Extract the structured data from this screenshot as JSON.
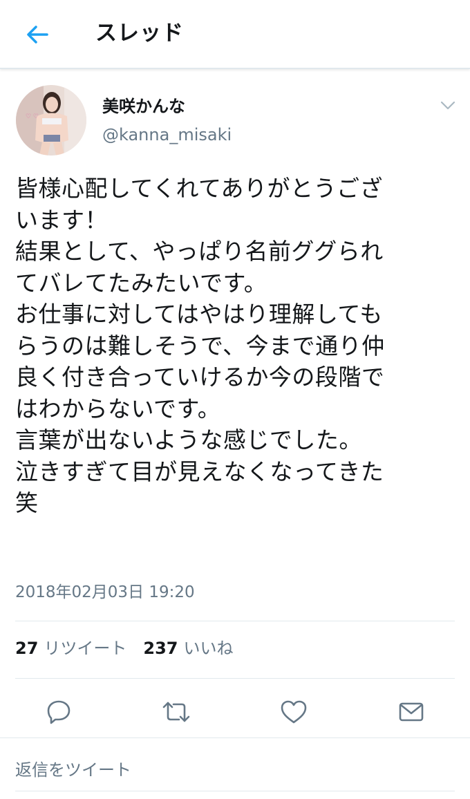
{
  "header": {
    "title": "スレッド",
    "back_icon": "arrow-left-icon",
    "accent": "#1da1f2"
  },
  "tweet": {
    "display_name": "美咲かんな",
    "handle": "@kanna_misaki",
    "text_lines": [
      "皆様心配してくれてありがとうござ",
      "います！",
      "結果として、やっぱり名前ググられ",
      "てバレてたみたいです。",
      "お仕事に対してはやはり理解しても",
      "らうのは難しそうで、今まで通り仲",
      "良く付き合っていけるか今の段階で",
      "はわからないです。",
      "言葉が出ないような感じでした。",
      "泣きすぎて目が見えなくなってきた",
      "笑"
    ],
    "timestamp": "2018年02月03日 19:20",
    "retweet_count": "27",
    "retweet_label": "リツイート",
    "like_count": "237",
    "like_label": "いいね"
  },
  "actions": {
    "reply_icon": "reply-icon",
    "retweet_icon": "retweet-icon",
    "like_icon": "heart-icon",
    "dm_icon": "envelope-icon"
  },
  "reply_box": {
    "placeholder": "返信をツイート"
  },
  "colors": {
    "text": "#14171a",
    "secondary": "#657786",
    "divider": "#e1e8ed",
    "icon": "#657786"
  }
}
